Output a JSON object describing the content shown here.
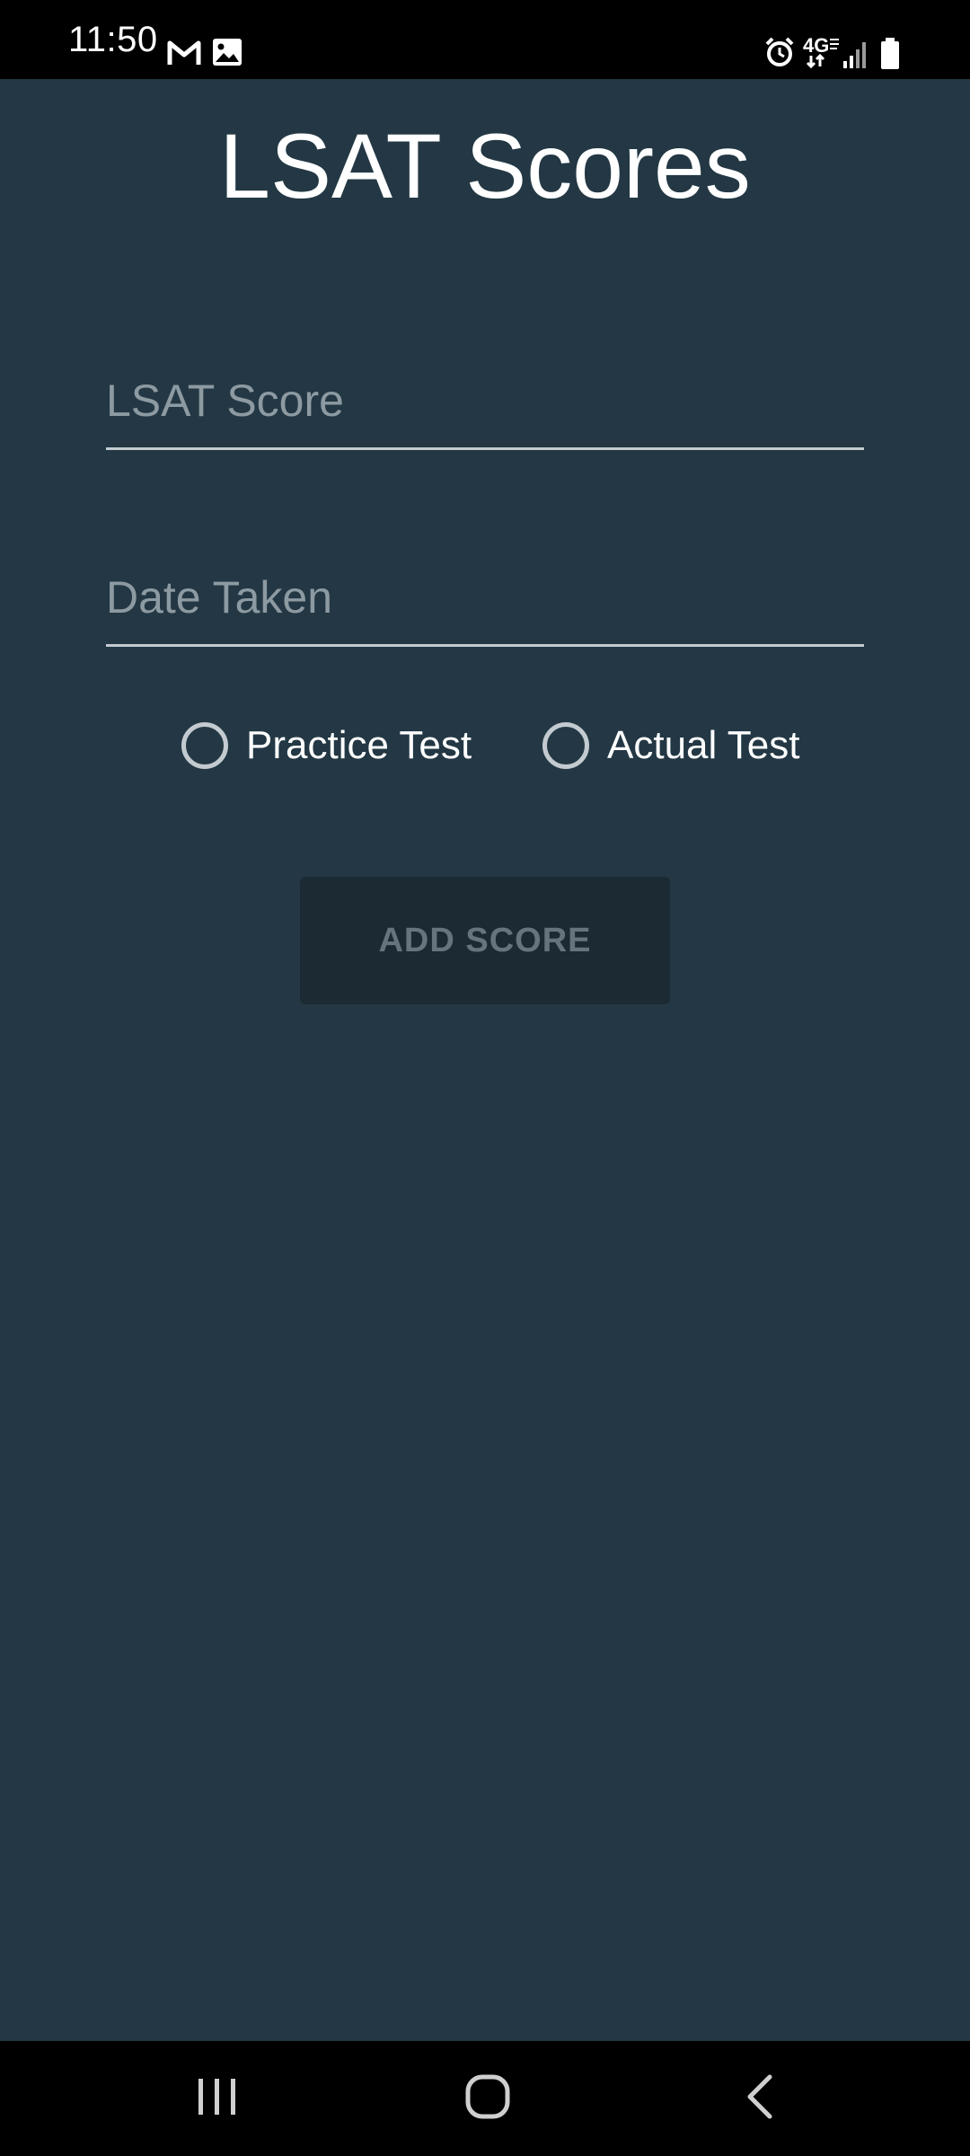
{
  "status_bar": {
    "time": "11:50",
    "icons": [
      "gmail-icon",
      "gallery-icon",
      "alarm-icon",
      "4g-network-icon",
      "signal-icon",
      "battery-icon"
    ]
  },
  "page": {
    "title": "LSAT Scores"
  },
  "form": {
    "score_placeholder": "LSAT Score",
    "score_value": "",
    "date_placeholder": "Date Taken",
    "date_value": "",
    "test_type_options": [
      {
        "label": "Practice Test",
        "checked": false
      },
      {
        "label": "Actual Test",
        "checked": false
      }
    ],
    "add_button_label": "ADD SCORE"
  },
  "nav_bar": {
    "icons": [
      "recents-icon",
      "home-icon",
      "back-icon"
    ]
  },
  "colors": {
    "background": "#233844",
    "button_background": "#1c2a33",
    "button_text_disabled": "#66747d",
    "placeholder": "#8d9aa2",
    "underline": "#c3cbd0"
  }
}
